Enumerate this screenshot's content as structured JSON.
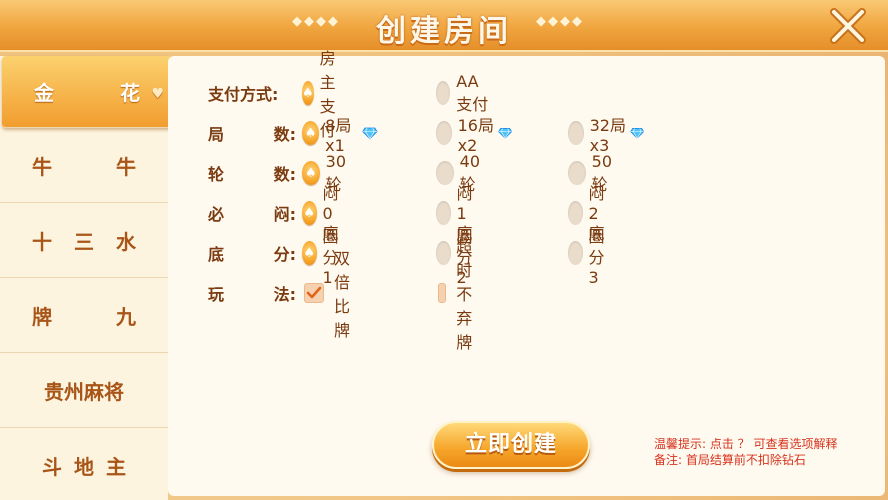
{
  "header": {
    "title": "创建房间",
    "deco_left": "◆◆◆◆",
    "deco_right": "◆◆◆◆"
  },
  "sidebar": {
    "items": [
      {
        "label": "金花",
        "chars": [
          "金",
          "花"
        ],
        "active": true
      },
      {
        "label": "牛牛",
        "chars": [
          "牛",
          "牛"
        ],
        "active": false
      },
      {
        "label": "十三水",
        "chars": [
          "十",
          "三",
          "水"
        ],
        "active": false
      },
      {
        "label": "牌九",
        "chars": [
          "牌",
          "九"
        ],
        "active": false
      },
      {
        "label": "贵州麻将",
        "active": false
      },
      {
        "label": "斗地主",
        "chars": [
          "斗",
          "地",
          "主"
        ],
        "active": false
      }
    ]
  },
  "options": {
    "payment": {
      "label": "支付方式:",
      "choices": [
        "房主支付",
        "AA支付"
      ],
      "selected": 0
    },
    "rounds": {
      "label": [
        "局",
        "数:"
      ],
      "choices": [
        "8局x1",
        "16局x2",
        "32局x3"
      ],
      "selected": 0
    },
    "turns": {
      "label": [
        "轮",
        "数:"
      ],
      "choices": [
        "30轮",
        "40轮",
        "50轮"
      ],
      "selected": 0
    },
    "blind": {
      "label": [
        "必",
        "闷:"
      ],
      "choices": [
        "闷0圈",
        "闷1圈",
        "闷2圈"
      ],
      "selected": 0
    },
    "base": {
      "label": [
        "底",
        "分:"
      ],
      "choices": [
        "底分1",
        "底分2",
        "底分3"
      ],
      "selected": 0
    },
    "rules": {
      "label": [
        "玩",
        "法:"
      ],
      "choices": [
        "双倍比牌",
        "超时不弃牌"
      ],
      "checked": [
        true,
        false
      ]
    }
  },
  "create_button": "立即创建",
  "tips": {
    "line1": "温馨提示: 点击 ？ 可查看选项解释",
    "line2": "备注: 首局结算前不扣除钻石"
  },
  "colors": {
    "accent": "#f29d2f",
    "text": "#7a3b10",
    "tip": "#d6321c"
  }
}
